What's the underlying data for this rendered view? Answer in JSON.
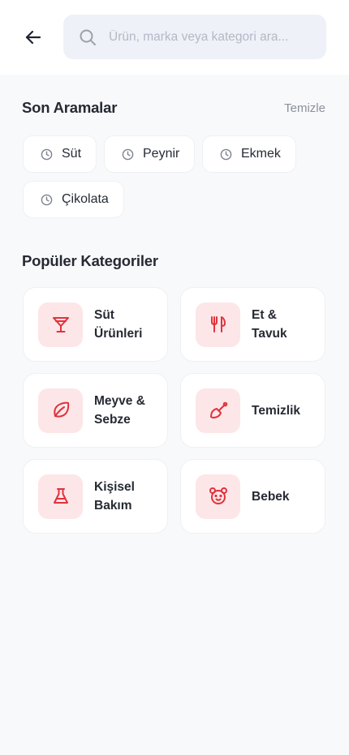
{
  "search": {
    "placeholder": "Ürün, marka veya kategori ara..."
  },
  "recent": {
    "title": "Son Aramalar",
    "clear_label": "Temizle",
    "items": [
      {
        "label": "Süt",
        "icon": "clock-icon"
      },
      {
        "label": "Peynir",
        "icon": "clock-icon"
      },
      {
        "label": "Ekmek",
        "icon": "clock-icon"
      },
      {
        "label": "Çikolata",
        "icon": "clock-icon"
      }
    ]
  },
  "categories": {
    "title": "Popüler Kategoriler",
    "items": [
      {
        "label": "Süt\nÜrünleri",
        "icon": "cocktail-glass-icon"
      },
      {
        "label": "Et &\nTavuk",
        "icon": "fork-knife-icon"
      },
      {
        "label": "Meyve &\nSebze",
        "icon": "leaf-icon"
      },
      {
        "label": "Temizlik",
        "icon": "cleaning-brush-icon"
      },
      {
        "label": "Kişisel\nBakım",
        "icon": "flask-icon"
      },
      {
        "label": "Bebek",
        "icon": "teddy-bear-icon"
      }
    ]
  },
  "colors": {
    "accent": "#e0333d",
    "accent_bg": "#fde6e8",
    "page_bg": "#f8f9fb",
    "muted": "#8a909c"
  }
}
